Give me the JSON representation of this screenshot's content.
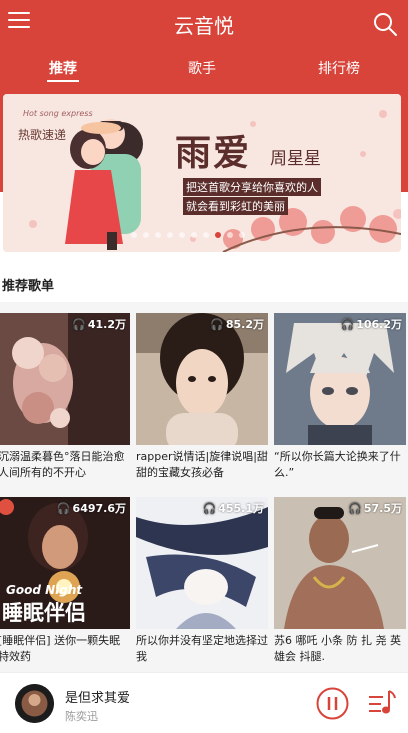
{
  "app": {
    "title": "云音悦"
  },
  "tabs": [
    {
      "label": "推荐"
    },
    {
      "label": "歌手"
    },
    {
      "label": "排行榜"
    }
  ],
  "banner": {
    "tag": "热歌速递",
    "small_caption": "Hot song express",
    "headline": "雨爱",
    "artist": "周星星",
    "line1": "把这首歌分享给你喜欢的人",
    "line2": "就会看到彩虹的美丽",
    "slides": 10,
    "active_slide": 7
  },
  "section": {
    "title": "推荐歌单"
  },
  "playlists": [
    {
      "plays": "41.2万",
      "title": "沉溺温柔暮色°落日能治愈人间所有的不开心"
    },
    {
      "plays": "85.2万",
      "title": "rapper说情话|旋律说唱|甜甜的宝藏女孩必备"
    },
    {
      "plays": "106.2万",
      "title": "“所以你长篇大论换来了什么.”"
    },
    {
      "plays": "6497.6万",
      "title": "[睡眠伴侣] 送你一颗失眠特效药",
      "overlay_title": "睡眠伴侣",
      "overlay_sub": "Good Night"
    },
    {
      "plays": "455.1万",
      "title": "所以你并没有坚定地选择过我"
    },
    {
      "plays": "57.5万",
      "title": "苏6 哪吒 小条 防 扎 尧 英雄会 抖腿."
    }
  ],
  "player": {
    "song": "是但求其爱",
    "artist": "陈奕迅"
  },
  "colors": {
    "brand": "#d8443a"
  }
}
